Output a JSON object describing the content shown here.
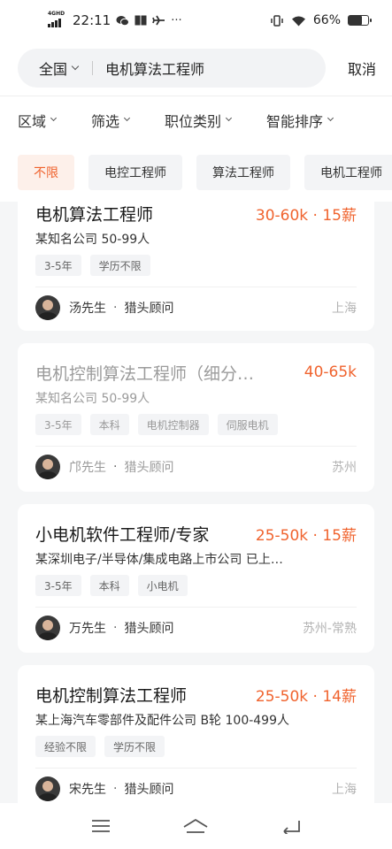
{
  "status_bar": {
    "network_label": "4GHD",
    "time": "22:11",
    "status_icons": [
      "signal-icon",
      "wechat-icon",
      "book-icon",
      "airplane-icon",
      "more-dots-icon"
    ],
    "battery_text": "66%",
    "battery_level": 0.66
  },
  "search": {
    "region": "全国",
    "query": "电机算法工程师",
    "cancel_label": "取消"
  },
  "filters": [
    "区域",
    "筛选",
    "职位类别",
    "智能排序"
  ],
  "chips": [
    {
      "label": "不限",
      "active": true
    },
    {
      "label": "电控工程师",
      "active": false
    },
    {
      "label": "算法工程师",
      "active": false
    },
    {
      "label": "电机工程师",
      "active": false
    }
  ],
  "jobs": [
    {
      "title": "电机算法工程师",
      "salary": "30-60k · 15薪",
      "company": "某知名公司  50-99人",
      "tags": [
        "3-5年",
        "学历不限"
      ],
      "recruiter": "汤先生",
      "role": "猎头顾问",
      "location": "上海",
      "viewed": false
    },
    {
      "title": "电机控制算法工程师（细分…",
      "salary": "40-65k",
      "company": "某知名公司  50-99人",
      "tags": [
        "3-5年",
        "本科",
        "电机控制器",
        "伺服电机"
      ],
      "recruiter": "邝先生",
      "role": "猎头顾问",
      "location": "苏州",
      "viewed": true
    },
    {
      "title": "小电机软件工程师/专家",
      "salary": "25-50k · 15薪",
      "company": "某深圳电子/半导体/集成电路上市公司  已上…",
      "tags": [
        "3-5年",
        "本科",
        "小电机"
      ],
      "recruiter": "万先生",
      "role": "猎头顾问",
      "location": "苏州-常熟",
      "viewed": false
    },
    {
      "title": "电机控制算法工程师",
      "salary": "25-50k · 14薪",
      "company": "某上海汽车零部件及配件公司  B轮  100-499人",
      "tags": [
        "经验不限",
        "学历不限"
      ],
      "recruiter": "宋先生",
      "role": "猎头顾问",
      "location": "上海",
      "viewed": false
    }
  ],
  "nav": [
    "menu-icon",
    "home-icon",
    "back-icon"
  ],
  "colors": {
    "accent": "#f0632e",
    "chip_active_bg": "#fdf0ea",
    "page_bg": "#f5f6f7"
  }
}
